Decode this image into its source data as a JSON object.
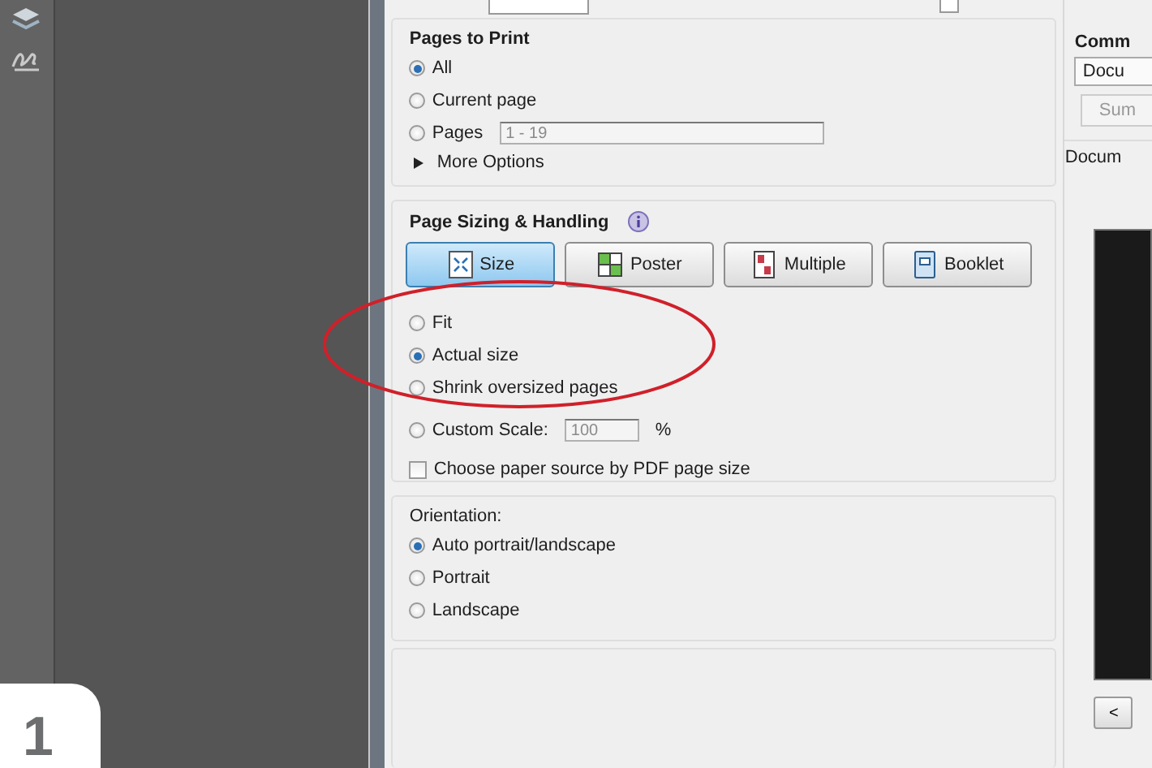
{
  "pages_to_print": {
    "title": "Pages to Print",
    "options": [
      {
        "label": "All",
        "selected": true
      },
      {
        "label": "Current page",
        "selected": false
      },
      {
        "label": "Pages",
        "selected": false,
        "field": "1 - 19"
      }
    ],
    "more_options": "More Options"
  },
  "page_sizing": {
    "title": "Page Sizing & Handling",
    "mode_buttons": [
      {
        "label": "Size",
        "kind": "size",
        "selected": true
      },
      {
        "label": "Poster",
        "kind": "poster",
        "selected": false
      },
      {
        "label": "Multiple",
        "kind": "multiple",
        "selected": false
      },
      {
        "label": "Booklet",
        "kind": "booklet",
        "selected": false
      }
    ],
    "options": [
      {
        "label": "Fit",
        "selected": false
      },
      {
        "label": "Actual size",
        "selected": true
      },
      {
        "label": "Shrink oversized pages",
        "selected": false
      },
      {
        "label": "Custom Scale:",
        "selected": false,
        "field": "100",
        "unit": "%"
      }
    ],
    "paper_source": {
      "label": "Choose paper source by PDF page size",
      "checked": false
    }
  },
  "orientation": {
    "title": "Orientation:",
    "options": [
      {
        "label": "Auto portrait/landscape",
        "selected": true
      },
      {
        "label": "Portrait",
        "selected": false
      },
      {
        "label": "Landscape",
        "selected": false
      }
    ]
  },
  "right_panel": {
    "title": "Comm",
    "dropdown": "Docu",
    "button": "Sum",
    "label": "Docum",
    "prev_button": "<"
  },
  "badge": "1",
  "top_checkbox": {
    "checked": false
  }
}
